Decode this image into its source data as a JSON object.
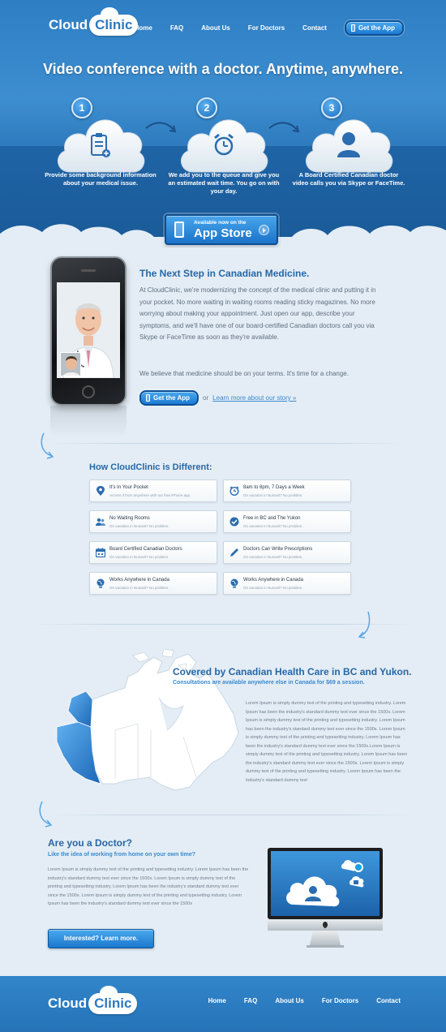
{
  "nav": {
    "logo_cloud": "Cloud",
    "logo_clinic": "Clinic",
    "links": [
      "Home",
      "FAQ",
      "About Us",
      "For Doctors",
      "Contact"
    ],
    "cta": "Get the App"
  },
  "hero": {
    "title": "Video conference with a doctor. Anytime, anywhere.",
    "steps": [
      {
        "num": "1",
        "icon": "clipboard-icon",
        "text": "Provide some background information about your medical issue."
      },
      {
        "num": "2",
        "icon": "alarm-clock-icon",
        "text": "We add you to the queue and give you an estimated wait time. You go on with your day."
      },
      {
        "num": "3",
        "icon": "person-icon",
        "text": "A Board Certified Canadian doctor video calls you via Skype or FaceTime."
      }
    ],
    "appstore_small": "Available now on the",
    "appstore_big": "App Store"
  },
  "intro": {
    "title": "The Next Step in Canadian Medicine.",
    "p1": "At CloudClinic, we're modernizing the concept of the medical clinic and putting it in your pocket. No more waiting in waiting rooms reading sticky magazines. No more worrying about making your appointment. Just open our app, describe your symptoms, and we'll have one of our board-certified Canadian doctors call you via Skype or FaceTime as soon as they're available.",
    "p2": "We believe that medicine should be on your terms. It's time for a change.",
    "cta": "Get the App",
    "or": "or",
    "story_link": "Learn more about our story »"
  },
  "different": {
    "title": "How CloudClinic is Different:",
    "features": [
      {
        "icon": "map-pin-icon",
        "title": "It's In Your Pocket",
        "sub": "Access it from anywhere with our free iPhone app."
      },
      {
        "icon": "clock-icon",
        "title": "8am to 8pm, 7 Days a Week",
        "sub": "On vacation in Nunavit? No problem."
      },
      {
        "icon": "people-icon",
        "title": "No Waiting Rooms",
        "sub": "On vacation in Nunavit? No problem."
      },
      {
        "icon": "checkmark-icon",
        "title": "Free in BC and The Yukon",
        "sub": "On vacation in Nunavit? No problem."
      },
      {
        "icon": "calendar-icon",
        "title": "Board Certified Canadian Doctors",
        "sub": "On vacation in Nunavit? No problem."
      },
      {
        "icon": "pen-icon",
        "title": "Doctors Can Write Prescriptions",
        "sub": "On vacation in Nunavit? No problem."
      },
      {
        "icon": "globe-icon",
        "title": "Works Anywhere in Canada",
        "sub": "On vacation in Nunavit? No problem."
      },
      {
        "icon": "globe-icon",
        "title": "Works Anywhere in Canada",
        "sub": "On vacation in Nunavit? No problem."
      }
    ]
  },
  "coverage": {
    "title": "Covered by Canadian Health Care in BC and Yukon.",
    "sub": "Consultations are available anywhere else in Canada for $69 a session.",
    "text": "Lorem Ipsum is simply dummy text of the printing and typesetting industry. Lorem Ipsum has been the industry's standard dummy text ever since the 1500s. Lorem Ipsum is simply dummy text of the printing and typesetting industry. Lorem Ipsum has been the industry's standard dummy text ever since the 1500s. Lorem Ipsum is simply dummy text of the printing and typesetting industry. Lorem Ipsum has been the industry's standard dummy text ever since the 1500s.Lorem Ipsum is simply dummy text of the printing and typesetting industry. Lorem Ipsum has been the industry's standard dummy text ever since the 1500s. Lorem Ipsum is simply dummy text of the printing and typesetting industry. Lorem Ipsum has been the industry's standard dummy text"
  },
  "doctor": {
    "title": "Are you a Doctor?",
    "sub": "Like the idea of working from home on your own time?",
    "text": "Lorem Ipsum is simply dummy text of the printing and typesetting industry. Lorem Ipsum has been the industry's standard dummy text ever since the 1500s. Lorem Ipsum is simply dummy text of the printing and typesetting industry. Lorem Ipsum has been the industry's standard dummy text ever since the 1500s. Lorem Ipsum is simply dummy text of the printing and typesetting industry. Lorem Ipsum has been the industry's standard dummy text ever since the 1500s",
    "cta": "Interested? Learn more."
  },
  "footer": {
    "logo_cloud": "Cloud",
    "logo_clinic": "Clinic",
    "links": [
      "Home",
      "FAQ",
      "About Us",
      "For Doctors",
      "Contact"
    ]
  },
  "colors": {
    "brand_blue": "#2d79c0",
    "heading_blue": "#2767a5",
    "accent_blue": "#3a8ad0",
    "page_bg": "#e4edf5"
  }
}
